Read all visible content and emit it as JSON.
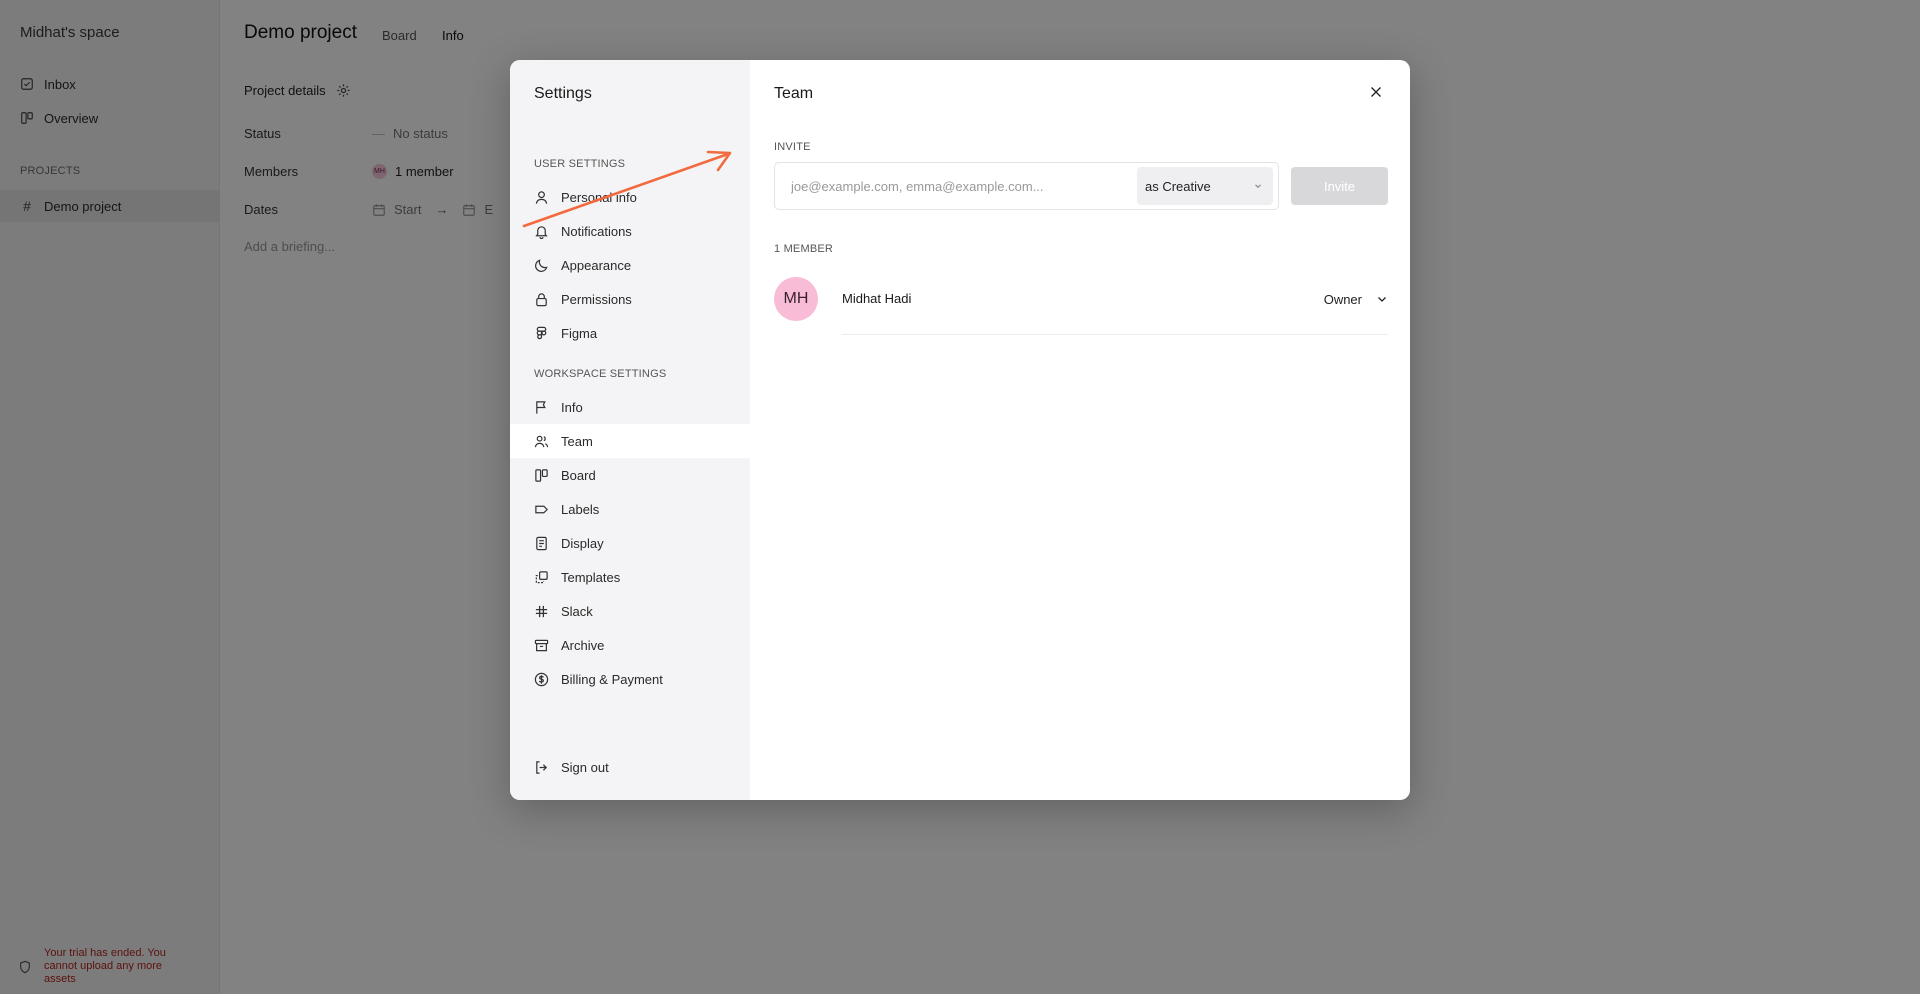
{
  "app": {
    "workspace_name": "Midhat's space",
    "nav": {
      "inbox": "Inbox",
      "overview": "Overview"
    },
    "projects_label": "PROJECTS",
    "projects": [
      "Demo project"
    ],
    "trial_message": "Your trial has ended. You cannot upload any more assets"
  },
  "project": {
    "title": "Demo project",
    "tabs": {
      "board": "Board",
      "info": "Info"
    },
    "details_heading": "Project details",
    "status_label": "Status",
    "status_value": "No status",
    "members_label": "Members",
    "members_value": "1 member",
    "members_avatar": "MH",
    "dates_label": "Dates",
    "dates_start": "Start",
    "dates_end": "E",
    "briefing_placeholder": "Add a briefing..."
  },
  "settings": {
    "title": "Settings",
    "user_section": "USER SETTINGS",
    "user_items": {
      "personal_info": "Personal info",
      "notifications": "Notifications",
      "appearance": "Appearance",
      "permissions": "Permissions",
      "figma": "Figma"
    },
    "workspace_section": "WORKSPACE SETTINGS",
    "workspace_items": {
      "info": "Info",
      "team": "Team",
      "board": "Board",
      "labels": "Labels",
      "display": "Display",
      "templates": "Templates",
      "slack": "Slack",
      "archive": "Archive",
      "billing": "Billing & Payment"
    },
    "sign_out": "Sign out",
    "active_item": "Team"
  },
  "team": {
    "title": "Team",
    "invite_label": "INVITE",
    "invite_placeholder": "joe@example.com, emma@example.com...",
    "role_selected": "as Creative",
    "invite_button": "Invite",
    "members_count_label": "1 MEMBER",
    "members": [
      {
        "initials": "MH",
        "name": "Midhat Hadi",
        "role": "Owner"
      }
    ]
  },
  "colors": {
    "annotation_arrow": "#f26a3d",
    "avatar_bg": "#f9bcd6",
    "trial_text": "#b3261e"
  }
}
